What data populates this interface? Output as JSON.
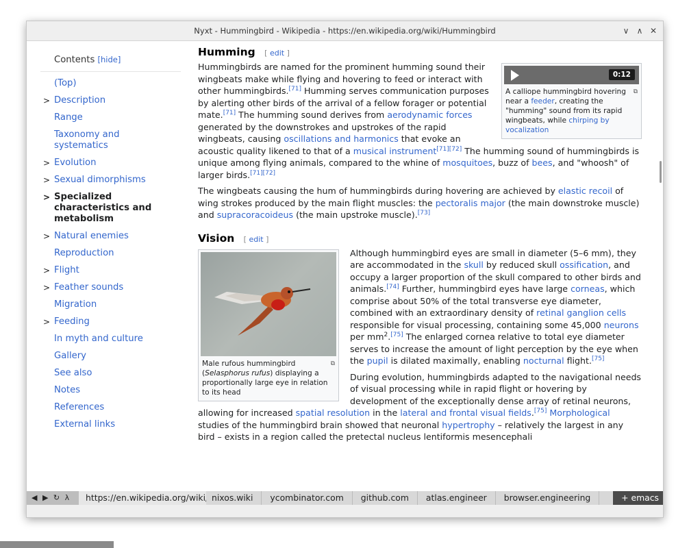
{
  "window": {
    "title": "Nyxt - Hummingbird - Wikipedia - https://en.wikipedia.org/wiki/Hummingbird",
    "controls": {
      "minimize": "∨",
      "maximize": "∧",
      "close": "✕"
    }
  },
  "toc": {
    "heading": "Contents",
    "hide_label": "[hide]",
    "items": [
      {
        "label": "(Top)",
        "expandable": false
      },
      {
        "label": "Description",
        "expandable": true
      },
      {
        "label": "Range",
        "expandable": false
      },
      {
        "label": "Taxonomy and systematics",
        "expandable": false
      },
      {
        "label": "Evolution",
        "expandable": true
      },
      {
        "label": "Sexual dimorphisms",
        "expandable": true
      },
      {
        "label": "Specialized characteristics and metabolism",
        "expandable": true,
        "active": true
      },
      {
        "label": "Natural enemies",
        "expandable": true
      },
      {
        "label": "Reproduction",
        "expandable": false
      },
      {
        "label": "Flight",
        "expandable": true
      },
      {
        "label": "Feather sounds",
        "expandable": true
      },
      {
        "label": "Migration",
        "expandable": false
      },
      {
        "label": "Feeding",
        "expandable": true
      },
      {
        "label": "In myth and culture",
        "expandable": false
      },
      {
        "label": "Gallery",
        "expandable": false
      },
      {
        "label": "See also",
        "expandable": false
      },
      {
        "label": "Notes",
        "expandable": false
      },
      {
        "label": "References",
        "expandable": false
      },
      {
        "label": "External links",
        "expandable": false
      }
    ]
  },
  "article": {
    "sections": {
      "humming": {
        "title": "Humming",
        "edit": "edit"
      },
      "vision": {
        "title": "Vision",
        "edit": "edit"
      }
    },
    "media": {
      "duration": "0:12",
      "caption_1": "A calliope hummingbird hovering near a ",
      "caption_link_1": "feeder",
      "caption_2": ", creating the \"humming\" sound from its rapid wingbeats, while ",
      "caption_link_2": "chirping by vocalization"
    },
    "figure": {
      "caption_1": "Male rufous hummingbird (",
      "caption_italic": "Selasphorus rufus",
      "caption_2": ") displaying a proportionally large eye in relation to its head"
    },
    "p1": {
      "t1": "Hummingbirds are named for the prominent humming sound their wingbeats make while flying and hovering to feed or interact with other hummingbirds.",
      "r1": "[71]",
      "t2": " Humming serves communication purposes by alerting other birds of the arrival of a fellow forager or potential mate.",
      "r2": "[71]",
      "t3": " The humming sound derives from ",
      "l1": "aerodynamic forces",
      "t4": " generated by the downstrokes and upstrokes of the rapid wingbeats, causing ",
      "l2": "oscillations and harmonics",
      "t5": " that evoke an acoustic quality likened to that of a ",
      "l3": "musical instrument",
      "r3": "[71][72]",
      "t6": " The humming sound of hummingbirds is unique among flying animals, compared to the whine of ",
      "l4": "mosquitoes",
      "t7": ", buzz of ",
      "l5": "bees",
      "t8": ", and \"whoosh\" of larger birds.",
      "r4": "[71][72]"
    },
    "p2": {
      "t1": "The wingbeats causing the hum of hummingbirds during hovering are achieved by ",
      "l1": "elastic recoil",
      "t2": " of wing strokes produced by the main flight muscles: the ",
      "l2": "pectoralis major",
      "t3": " (the main downstroke muscle) and ",
      "l3": "supracoracoideus",
      "t4": " (the main upstroke muscle).",
      "r1": "[73]"
    },
    "p3": {
      "t1": "Although hummingbird eyes are small in diameter (5–6 mm), they are accommodated in the ",
      "l1": "skull",
      "t2": " by reduced skull ",
      "l2": "ossification",
      "t3": ", and occupy a larger proportion of the skull compared to other birds and animals.",
      "r1": "[74]",
      "t4": " Further, hummingbird eyes have large ",
      "l3": "corneas",
      "t5": ", which comprise about 50% of the total transverse eye diameter, combined with an extraordinary density of ",
      "l4": "retinal ganglion cells",
      "t6": " responsible for visual processing, containing some 45,000 ",
      "l5": "neurons",
      "t7": " per mm",
      "sq": "2",
      "t8": ".",
      "r2": "[75]",
      "t9": " The enlarged cornea relative to total eye diameter serves to increase the amount of light perception by the eye when the ",
      "l6": "pupil",
      "t10": " is dilated maximally, enabling ",
      "l7": "nocturnal",
      "t11": " flight.",
      "r3": "[75]"
    },
    "p4": {
      "t1": "During evolution, hummingbirds adapted to the navigational needs of visual processing while in rapid flight or hovering by development of the exceptionally dense array of retinal neurons, allowing for increased ",
      "l1": "spatial resolution",
      "t2": " in the ",
      "l2": "lateral and frontal visual fields",
      "t3": ".",
      "r1": "[75]",
      "t4": " ",
      "l3": "Morphological",
      "t5": " studies of the hummingbird brain showed that neuronal ",
      "l4": "hypertrophy",
      "t6": " – relatively the largest in any bird – exists in a region called the pretectal nucleus lentiformis mesencephali"
    }
  },
  "statusbar": {
    "nav_glyphs": "◀ ▶ ↻ λ",
    "url": "https://en.wikipedia.org/wiki/Hummingbird",
    "buffers": [
      "nixos.wiki",
      "ycombinator.com",
      "github.com",
      "atlas.engineer",
      "browser.engineering"
    ],
    "mode": "+ emacs"
  },
  "colors": {
    "link": "#3366cc",
    "text": "#202122",
    "statusbar": "#d8d8d8"
  }
}
